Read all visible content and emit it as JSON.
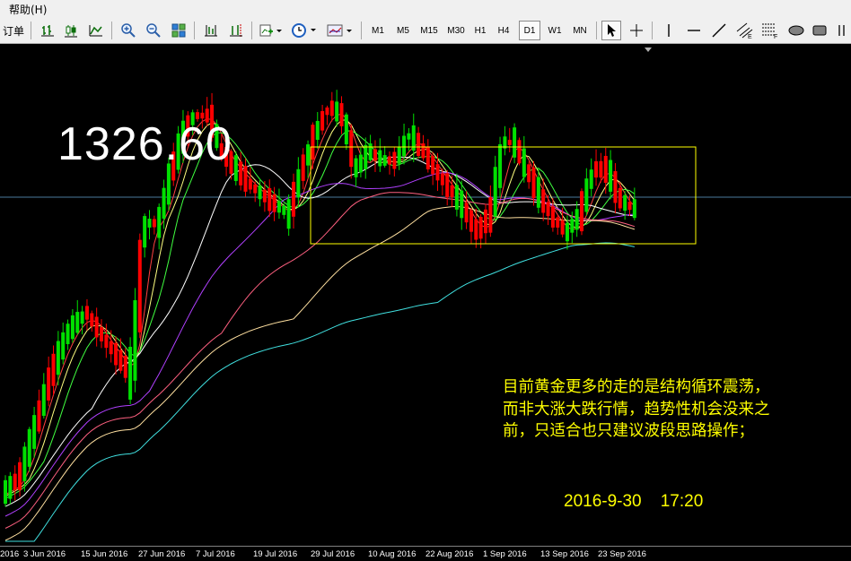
{
  "menu": {
    "help": "帮助(H)"
  },
  "toolbar": {
    "order_label": "订单",
    "timeframes": [
      "M1",
      "M5",
      "M15",
      "M30",
      "H1",
      "H4",
      "D1",
      "W1",
      "MN"
    ],
    "active_timeframe": "D1"
  },
  "chart": {
    "price_label": "1326.60",
    "comment": "目前黄金更多的走的是结构循环震荡，而非大涨大跌行情，趋势性机会没来之前，只适合也只建议波段思路操作；",
    "timestamp": "2016-9-30    17:20",
    "x_labels": [
      "2016",
      "3 Jun 2016",
      "15 Jun 2016",
      "27 Jun 2016",
      "7 Jul 2016",
      "19 Jul 2016",
      "29 Jul 2016",
      "10 Aug 2016",
      "22 Aug 2016",
      "1 Sep 2016",
      "13 Sep 2016",
      "23 Sep 2016"
    ],
    "colors": {
      "up": "#00e000",
      "down": "#ff0000",
      "box": "#ffff00",
      "grid_line": "#4a7a9c"
    }
  },
  "icons": [
    "bar-chart-icon",
    "candle-chart-icon",
    "line-chart-icon",
    "zoom-in-icon",
    "zoom-out-icon",
    "tile-windows-icon",
    "period-separator-icon",
    "chart-shift-icon",
    "indicators-icon",
    "clock-icon",
    "templates-icon",
    "cursor-icon",
    "crosshair-icon",
    "vertical-line-icon",
    "horizontal-line-icon",
    "trendline-icon",
    "equidistant-channel-icon",
    "fibonacci-icon",
    "ellipse-icon",
    "rectangle-icon"
  ]
}
